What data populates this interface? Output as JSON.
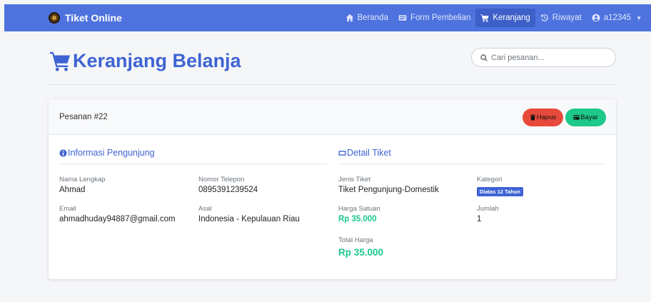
{
  "app": {
    "title": "Tiket Online"
  },
  "nav": {
    "items": [
      {
        "label": "Beranda",
        "icon": "home-icon",
        "active": false
      },
      {
        "label": "Form Pembelian",
        "icon": "form-icon",
        "active": false
      },
      {
        "label": "Keranjang",
        "icon": "cart-icon",
        "active": true
      },
      {
        "label": "Riwayat",
        "icon": "history-icon",
        "active": false
      }
    ],
    "user": {
      "label": "a12345",
      "icon": "user-circle-icon"
    }
  },
  "page": {
    "title": "Keranjang Belanja",
    "search_placeholder": "Cari pesanan..."
  },
  "order": {
    "header": "Pesanan #22",
    "delete_label": "Hapus",
    "pay_label": "Bayar",
    "visitor": {
      "section_title": "Informasi Pengunjung",
      "name_label": "Nama Lengkap",
      "name": "Ahmad",
      "phone_label": "Nomor Telepon",
      "phone": "0895391239524",
      "email_label": "Email",
      "email": "ahmadhuday94887@gmail.com",
      "origin_label": "Asal",
      "origin": "Indonesia - Kepulauan Riau"
    },
    "ticket": {
      "section_title": "Detail Tiket",
      "type_label": "Jenis Tiket",
      "type": "Tiket Pengunjung-Domestik",
      "category_label": "Kategori",
      "category": "Diatas 12 Tahun",
      "unit_price_label": "Harga Satuan",
      "unit_price": "Rp 35.000",
      "qty_label": "Jumlah",
      "qty": "1",
      "total_label": "Total Harga",
      "total": "Rp 35.000"
    }
  },
  "colors": {
    "navbar": "#4e73df",
    "primary": "#3e64d3",
    "success": "#1cc88a",
    "danger": "#e74a3b"
  }
}
